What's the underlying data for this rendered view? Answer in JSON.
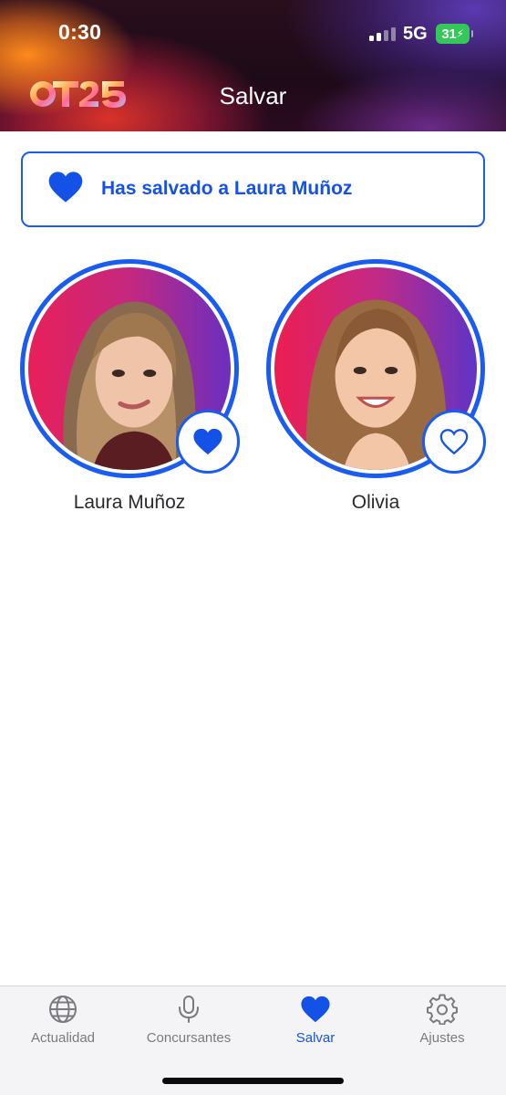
{
  "status_bar": {
    "time": "0:30",
    "network": "5G",
    "battery": "31"
  },
  "header": {
    "logo_text": "OT25",
    "title": "Salvar"
  },
  "banner": {
    "text": "Has salvado a Laura Muñoz"
  },
  "contestants": [
    {
      "name": "Laura Muñoz",
      "saved": true
    },
    {
      "name": "Olivia",
      "saved": false
    }
  ],
  "tabs": [
    {
      "label": "Actualidad",
      "icon": "globe-icon",
      "active": false
    },
    {
      "label": "Concursantes",
      "icon": "microphone-icon",
      "active": false
    },
    {
      "label": "Salvar",
      "icon": "heart-icon",
      "active": true
    },
    {
      "label": "Ajustes",
      "icon": "gear-icon",
      "active": false
    }
  ],
  "colors": {
    "accent": "#1a5cf0",
    "battery": "#34c759"
  }
}
